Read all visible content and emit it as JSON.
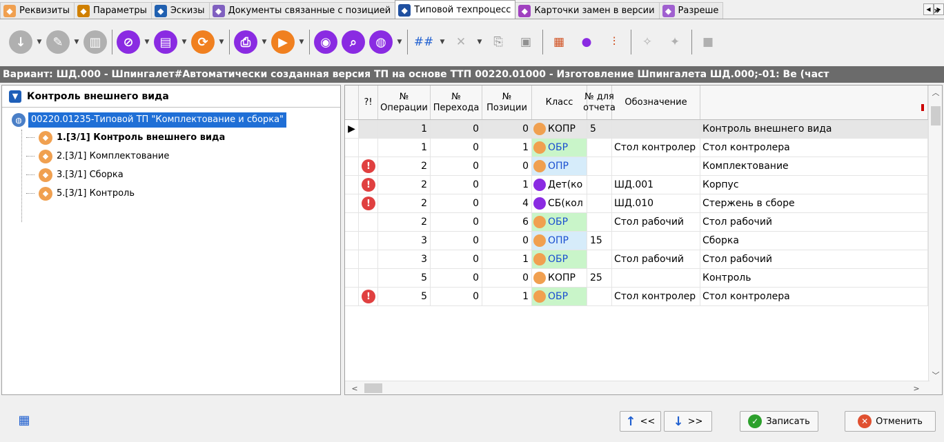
{
  "tabs": [
    {
      "label": "Реквизиты",
      "icon": "bell-icon",
      "color": "#f0a050"
    },
    {
      "label": "Параметры",
      "icon": "parameters-icon",
      "color": "#d08000"
    },
    {
      "label": "Эскизы",
      "icon": "sketch-icon",
      "color": "#2060b0"
    },
    {
      "label": "Документы связанные с позицией",
      "icon": "documents-icon",
      "color": "#8060c0"
    },
    {
      "label": "Типовой техпроцесс",
      "icon": "techprocess-icon",
      "color": "#2050a0"
    },
    {
      "label": "Карточки замен в версии",
      "icon": "replace-cards-icon",
      "color": "#a040c0"
    },
    {
      "label": "Разреше",
      "icon": "permission-icon",
      "color": "#a060d0"
    }
  ],
  "toolbar": {
    "buttons": [
      {
        "icon": "download-icon",
        "color": "#b0b0b0",
        "glyph": "↓"
      },
      {
        "icon": "edit-icon",
        "color": "#b0b0b0",
        "glyph": "✎"
      },
      {
        "icon": "columns-icon",
        "color": "#b0b0b0",
        "glyph": "▥"
      },
      {
        "icon": "link-icon",
        "color": "#8a2be2",
        "glyph": "⊘"
      },
      {
        "icon": "list-icon",
        "color": "#8a2be2",
        "glyph": "▤"
      },
      {
        "icon": "refresh-icon",
        "color": "#f08020",
        "glyph": "⟳"
      },
      {
        "icon": "print-icon",
        "color": "#8a2be2",
        "glyph": "⎙"
      },
      {
        "icon": "play-icon",
        "color": "#f08020",
        "glyph": "▶"
      },
      {
        "icon": "eye-icon",
        "color": "#8a2be2",
        "glyph": "◉"
      },
      {
        "icon": "search-icon",
        "color": "#8a2be2",
        "glyph": "⌕"
      },
      {
        "icon": "globe-icon",
        "color": "#8a2be2",
        "glyph": "◍"
      }
    ],
    "tools": [
      {
        "icon": "numbering-icon",
        "glyph": "##",
        "color": "#1f5fd0"
      },
      {
        "icon": "delete-icon",
        "glyph": "✕",
        "color": "#b0b0b0"
      },
      {
        "icon": "copy-icon",
        "glyph": "⎘",
        "color": "#909090"
      },
      {
        "icon": "paste-icon",
        "glyph": "▣",
        "color": "#909090"
      },
      {
        "icon": "calendar-icon",
        "glyph": "▦",
        "color": "#d05020"
      },
      {
        "icon": "user-icon",
        "glyph": "●",
        "color": "#8a2be2"
      },
      {
        "icon": "split-icon",
        "glyph": "⫶",
        "color": "#d05020"
      },
      {
        "icon": "magic-icon",
        "glyph": "✧",
        "color": "#b0b0b0"
      },
      {
        "icon": "wand-icon",
        "glyph": "✦",
        "color": "#b0b0b0"
      },
      {
        "icon": "box-icon",
        "glyph": "■",
        "color": "#b0b0b0"
      }
    ],
    "more": "»"
  },
  "variant": "Вариант: ШД.000 - Шпингалет#Автоматически созданная версия ТП на основе ТТП 00220.01000 - Изготовление Шпингалета ШД.000;-01: Ве (част",
  "left_panel": {
    "title": "Контроль внешнего вида",
    "root": "00220.01235-Типовой ТП \"Комплектование и сборка\"",
    "items": [
      {
        "label": "1.[3/1] Контроль внешнего вида",
        "bold": true
      },
      {
        "label": "2.[3/1] Комплектование",
        "bold": false
      },
      {
        "label": "3.[3/1] Сборка",
        "bold": false
      },
      {
        "label": "5.[3/1] Контроль",
        "bold": false
      }
    ]
  },
  "table": {
    "headers": [
      "",
      "?!",
      "№\nОперации",
      "№\nПерехода",
      "№\nПозиции",
      "Класс",
      "№ для\nотчета",
      "Обозначение",
      ""
    ],
    "rows": [
      {
        "pointer": "▶",
        "err": false,
        "op": "1",
        "tr": "0",
        "pos": "0",
        "cls": "КОПР",
        "cls_type": "kopr",
        "rep": "5",
        "des": "",
        "name": "Контроль внешнего вида"
      },
      {
        "pointer": "",
        "err": false,
        "op": "1",
        "tr": "0",
        "pos": "1",
        "cls": "ОБР",
        "cls_type": "obr",
        "rep": "",
        "des": "Стол контролер",
        "name": "Стол контролера"
      },
      {
        "pointer": "",
        "err": true,
        "op": "2",
        "tr": "0",
        "pos": "0",
        "cls": "ОПР",
        "cls_type": "opr",
        "rep": "",
        "des": "",
        "name": "Комплектование"
      },
      {
        "pointer": "",
        "err": true,
        "op": "2",
        "tr": "0",
        "pos": "1",
        "cls": "Дет(ко",
        "cls_type": "det",
        "rep": "",
        "des": "ШД.001",
        "name": "Корпус"
      },
      {
        "pointer": "",
        "err": true,
        "op": "2",
        "tr": "0",
        "pos": "4",
        "cls": "СБ(кол",
        "cls_type": "sb",
        "rep": "",
        "des": "ШД.010",
        "name": "Стержень в сборе"
      },
      {
        "pointer": "",
        "err": false,
        "op": "2",
        "tr": "0",
        "pos": "6",
        "cls": "ОБР",
        "cls_type": "obr",
        "rep": "",
        "des": "Стол рабочий",
        "name": "Стол рабочий"
      },
      {
        "pointer": "",
        "err": false,
        "op": "3",
        "tr": "0",
        "pos": "0",
        "cls": "ОПР",
        "cls_type": "opr",
        "rep": "15",
        "des": "",
        "name": "Сборка"
      },
      {
        "pointer": "",
        "err": false,
        "op": "3",
        "tr": "0",
        "pos": "1",
        "cls": "ОБР",
        "cls_type": "obr",
        "rep": "",
        "des": "Стол рабочий",
        "name": "Стол рабочий"
      },
      {
        "pointer": "",
        "err": false,
        "op": "5",
        "tr": "0",
        "pos": "0",
        "cls": "КОПР",
        "cls_type": "kopr",
        "rep": "25",
        "des": "",
        "name": "Контроль"
      },
      {
        "pointer": "",
        "err": true,
        "op": "5",
        "tr": "0",
        "pos": "1",
        "cls": "ОБР",
        "cls_type": "obr",
        "rep": "",
        "des": "Стол контролер",
        "name": "Стол контролера"
      }
    ]
  },
  "bottom": {
    "prev_label": "<<",
    "next_label": ">>",
    "save_label": "Записать",
    "cancel_label": "Отменить"
  }
}
